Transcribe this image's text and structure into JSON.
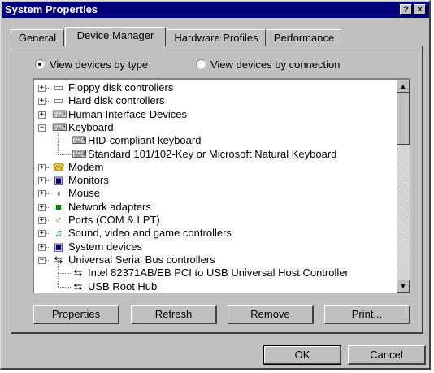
{
  "window": {
    "title": "System Properties",
    "help_glyph": "?",
    "close_glyph": "×"
  },
  "tabs": [
    {
      "label": "General"
    },
    {
      "label": "Device Manager"
    },
    {
      "label": "Hardware Profiles"
    },
    {
      "label": "Performance"
    }
  ],
  "view_options": {
    "by_type": "View devices by type",
    "by_connection": "View devices by connection",
    "selected": "by_type"
  },
  "tree": [
    {
      "label": "Floppy disk controllers",
      "icon": "floppy-icon",
      "glyph": "▭",
      "color": "#606060",
      "expander": "+"
    },
    {
      "label": "Hard disk controllers",
      "icon": "hard-disk-icon",
      "glyph": "▭",
      "color": "#606060",
      "expander": "+"
    },
    {
      "label": "Human Interface Devices",
      "icon": "hid-icon",
      "glyph": "⌨",
      "color": "#606060",
      "expander": "+"
    },
    {
      "label": "Keyboard",
      "icon": "keyboard-icon",
      "glyph": "⌨",
      "color": "#404040",
      "expander": "−"
    },
    {
      "label": "HID-compliant keyboard",
      "icon": "keyboard-icon",
      "glyph": "⌨",
      "color": "#404040",
      "expander": ""
    },
    {
      "label": "Standard 101/102-Key or Microsoft Natural Keyboard",
      "icon": "keyboard-icon",
      "glyph": "⌨",
      "color": "#404040",
      "expander": ""
    },
    {
      "label": "Modem",
      "icon": "modem-icon",
      "glyph": "☎",
      "color": "#c8a000",
      "expander": "+"
    },
    {
      "label": "Monitors",
      "icon": "monitor-icon",
      "glyph": "▣",
      "color": "#00007b",
      "expander": "+"
    },
    {
      "label": "Mouse",
      "icon": "mouse-icon",
      "glyph": "◖",
      "color": "#606060",
      "expander": "+"
    },
    {
      "label": "Network adapters",
      "icon": "network-icon",
      "glyph": "■",
      "color": "#008000",
      "expander": "+"
    },
    {
      "label": "Ports (COM & LPT)",
      "icon": "port-icon",
      "glyph": "♂",
      "color": "#806000",
      "expander": "+"
    },
    {
      "label": "Sound, video and game controllers",
      "icon": "sound-icon",
      "glyph": "♫",
      "color": "#008080",
      "expander": "+"
    },
    {
      "label": "System devices",
      "icon": "system-icon",
      "glyph": "▣",
      "color": "#00007b",
      "expander": "+"
    },
    {
      "label": "Universal Serial Bus controllers",
      "icon": "usb-icon",
      "glyph": "⇆",
      "color": "#000000",
      "expander": "−"
    },
    {
      "label": "Intel 82371AB/EB PCI to USB Universal Host Controller",
      "icon": "usb-icon",
      "glyph": "⇆",
      "color": "#000000",
      "expander": ""
    },
    {
      "label": "USB Root Hub",
      "icon": "usb-icon",
      "glyph": "⇆",
      "color": "#000000",
      "expander": ""
    }
  ],
  "panel_buttons": {
    "properties": "Properties",
    "refresh": "Refresh",
    "remove": "Remove",
    "print": "Print..."
  },
  "dialog_buttons": {
    "ok": "OK",
    "cancel": "Cancel"
  },
  "scrollbar": {
    "up_glyph": "▲",
    "down_glyph": "▼"
  }
}
